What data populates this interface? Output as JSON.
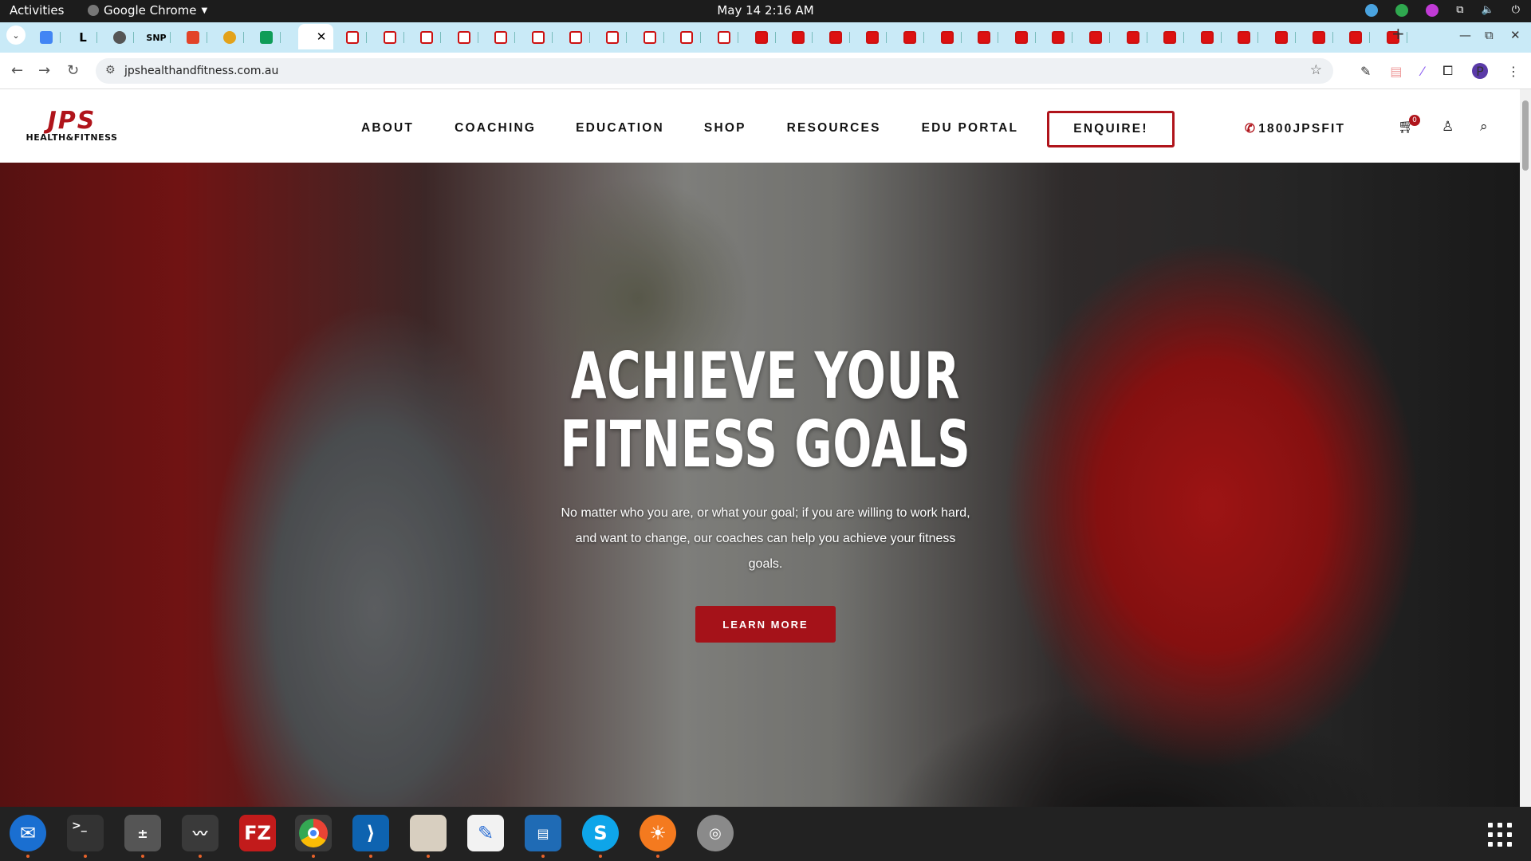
{
  "system": {
    "activities": "Activities",
    "app_name": "Google Chrome",
    "clock": "May 14  2:16 AM"
  },
  "browser": {
    "url": "jpshealthandfitness.com.au",
    "avatar_letter": "P"
  },
  "site": {
    "logo_mark": "JPS",
    "logo_sub": "HEALTH&FITNESS",
    "nav": [
      "ABOUT",
      "COACHING",
      "EDUCATION",
      "SHOP",
      "RESOURCES",
      "EDU PORTAL"
    ],
    "enquire": "ENQUIRE!",
    "phone": "1800JPSFIT",
    "cart_count": "0",
    "accent": "#b0141b"
  },
  "hero": {
    "title_line1": "ACHIEVE YOUR",
    "title_line2": "FITNESS GOALS",
    "body": "No matter who you are, or what your goal; if you are willing to work hard, and want to change, our coaches can help you achieve your fitness goals.",
    "cta": "LEARN MORE"
  },
  "dock": [
    "thunderbird-icon",
    "terminal-icon",
    "calculator-icon",
    "system-monitor-icon",
    "filezilla-icon",
    "chrome-icon",
    "vscode-icon",
    "files-icon",
    "text-editor-icon",
    "libreoffice-writer-icon",
    "skype-icon",
    "firefox-icon",
    "disk-utility-icon",
    "app-grid-icon"
  ]
}
